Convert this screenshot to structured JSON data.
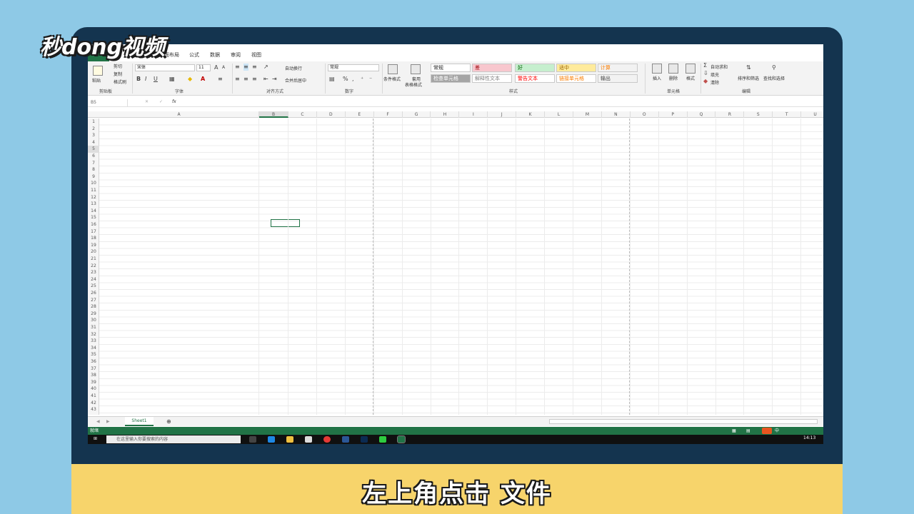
{
  "branding": {
    "logo_text": "秒dong视频"
  },
  "caption": "左上角点击 文件",
  "excel": {
    "tabs": [
      "页面布局",
      "公式",
      "数据",
      "审阅",
      "视图"
    ],
    "clipboard": {
      "cut": "剪切",
      "copy": "复制",
      "format_painter": "格式刷",
      "paste": "粘贴",
      "group": "剪贴板"
    },
    "font": {
      "name": "宋体",
      "size": "11",
      "group": "字体",
      "bold": "B",
      "italic": "I",
      "underline": "U"
    },
    "alignment": {
      "wrap": "自动换行",
      "merge": "合并后居中",
      "group": "对齐方式"
    },
    "number": {
      "format": "常规",
      "percent": "%",
      "comma": ",",
      "group": "数字"
    },
    "styles": {
      "conditional": "条件格式",
      "table": "套用",
      "table2": "表格格式",
      "cells": [
        {
          "label": "常规",
          "bg": "#ffffff",
          "fg": "#222222"
        },
        {
          "label": "差",
          "bg": "#f8c7ce",
          "fg": "#9c0006"
        },
        {
          "label": "好",
          "bg": "#c6efce",
          "fg": "#006100"
        },
        {
          "label": "适中",
          "bg": "#ffeb9c",
          "fg": "#9c6500"
        },
        {
          "label": "计算",
          "bg": "#f2f2f2",
          "fg": "#fa7d00"
        },
        {
          "label": "检查单元格",
          "bg": "#a5a5a5",
          "fg": "#ffffff"
        },
        {
          "label": "解释性文本",
          "bg": "#ffffff",
          "fg": "#7f7f7f"
        },
        {
          "label": "警告文本",
          "bg": "#ffffff",
          "fg": "#ff0000"
        },
        {
          "label": "链接单元格",
          "bg": "#ffffff",
          "fg": "#fa7d00"
        },
        {
          "label": "输出",
          "bg": "#f2f2f2",
          "fg": "#3f3f3f"
        }
      ],
      "group": "样式"
    },
    "cells_group": {
      "insert": "插入",
      "delete": "删除",
      "format": "格式",
      "group": "单元格"
    },
    "editing": {
      "autosum": "自动求和",
      "fill": "填充",
      "clear": "清除",
      "sort": "排序和筛选",
      "find": "查找和选择",
      "group": "编辑"
    },
    "formula_bar": {
      "name_box": "B5",
      "fx": "fx"
    },
    "columns": [
      "A",
      "B",
      "C",
      "D",
      "E",
      "F",
      "G",
      "H",
      "I",
      "J",
      "K",
      "L",
      "M",
      "N",
      "O",
      "P",
      "Q",
      "R",
      "S",
      "T",
      "U"
    ],
    "rows": [
      "1",
      "2",
      "3",
      "4",
      "5",
      "6",
      "7",
      "8",
      "9",
      "10",
      "11",
      "12",
      "13",
      "14",
      "15",
      "16",
      "17",
      "18",
      "19",
      "20",
      "21",
      "22",
      "23",
      "24",
      "25",
      "26",
      "27",
      "28",
      "29",
      "30",
      "31",
      "32",
      "33",
      "34",
      "35",
      "36",
      "37",
      "38",
      "39",
      "40",
      "41",
      "42",
      "43"
    ],
    "sheet_tab": "Sheet1",
    "add_sheet": "⊕",
    "status": "就绪",
    "taskbar": {
      "search": "在这里输入你要搜索的内容",
      "time": "14:13",
      "ime": "中"
    }
  }
}
